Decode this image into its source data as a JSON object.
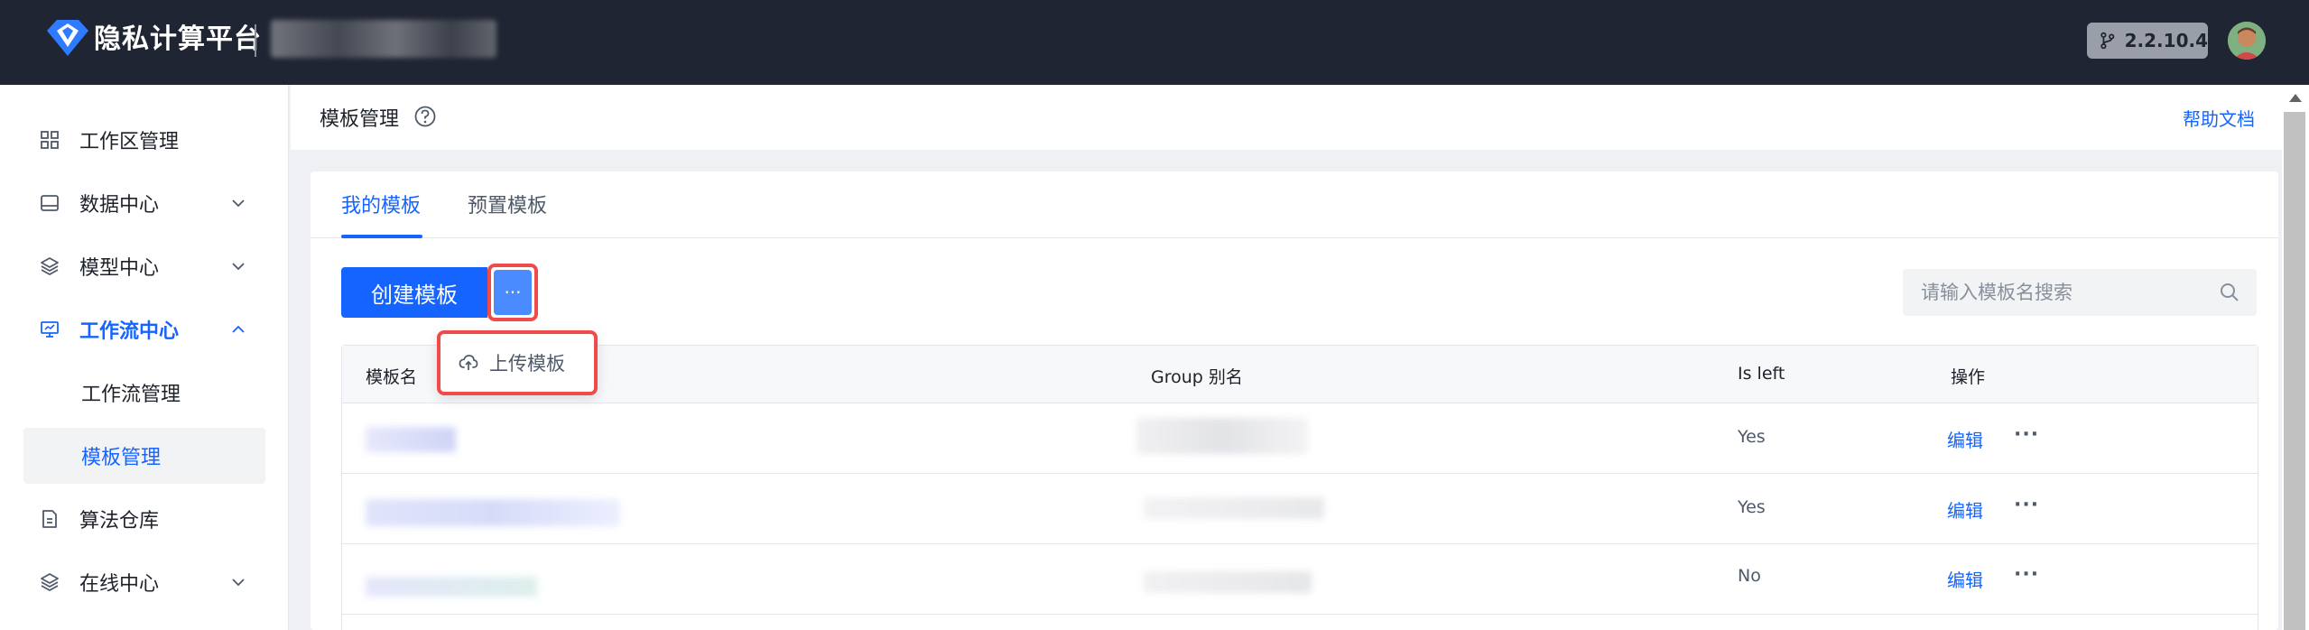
{
  "app": {
    "title": "隐私计算平台",
    "version": "2.2.10.4",
    "brand_color": "#1664ff"
  },
  "sidebar": {
    "items": [
      {
        "label": "工作区管理",
        "icon": "grid-icon"
      },
      {
        "label": "数据中心",
        "icon": "database-icon",
        "expandable": true
      },
      {
        "label": "模型中心",
        "icon": "layers-icon",
        "expandable": true
      },
      {
        "label": "工作流中心",
        "icon": "monitor-icon",
        "expandable": true,
        "expanded": true,
        "active": true
      },
      {
        "label": "算法仓库",
        "icon": "document-icon"
      },
      {
        "label": "在线中心",
        "icon": "layers-icon",
        "expandable": true
      }
    ],
    "workflow_children": [
      {
        "label": "工作流管理"
      },
      {
        "label": "模板管理",
        "selected": true
      }
    ]
  },
  "page": {
    "title": "模板管理",
    "help_link": "帮助文档"
  },
  "tabs": [
    {
      "label": "我的模板",
      "active": true
    },
    {
      "label": "预置模板"
    }
  ],
  "toolbar": {
    "create_label": "创建模板",
    "more_label": "···",
    "dropdown_upload": "上传模板"
  },
  "search": {
    "placeholder": "请输入模板名搜索"
  },
  "table": {
    "columns": [
      "模板名",
      "Group 别名",
      "Is left",
      "操作"
    ],
    "rows": [
      {
        "is_left": "Yes",
        "edit": "编辑",
        "more": "···"
      },
      {
        "is_left": "Yes",
        "edit": "编辑",
        "more": "···"
      },
      {
        "is_left": "No",
        "edit": "编辑",
        "more": "···"
      }
    ]
  }
}
